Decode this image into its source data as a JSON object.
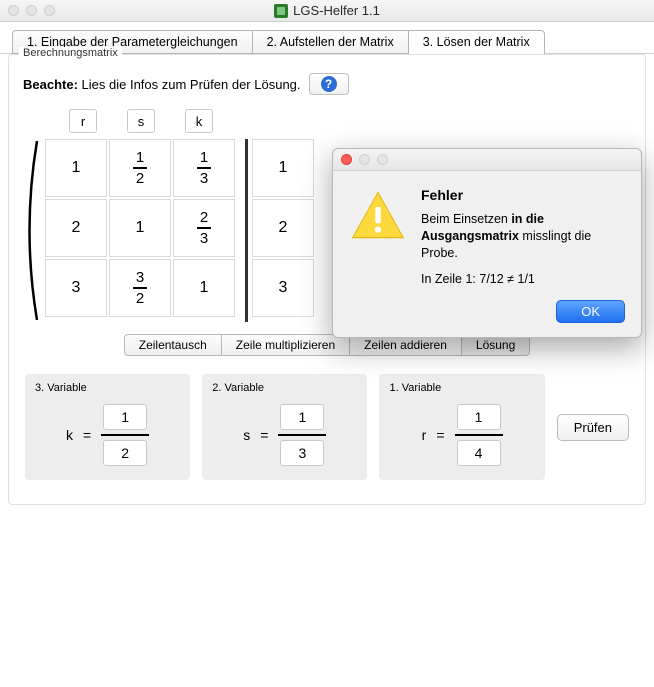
{
  "window": {
    "title": "LGS-Helfer 1.1"
  },
  "tabs": [
    {
      "label": "1. Eingabe der Parametergleichungen"
    },
    {
      "label": "2. Aufstellen der Matrix"
    },
    {
      "label": "3. Lösen der Matrix"
    }
  ],
  "frame_label": "Berechnungsmatrix",
  "notice": {
    "bold": "Beachte:",
    "text": "Lies die Infos zum Prüfen der Lösung."
  },
  "col_headers": [
    "r",
    "s",
    "k"
  ],
  "matrix": [
    [
      "1",
      {
        "n": "1",
        "d": "2"
      },
      {
        "n": "1",
        "d": "3"
      }
    ],
    [
      "2",
      "1",
      {
        "n": "2",
        "d": "3"
      }
    ],
    [
      "3",
      {
        "n": "3",
        "d": "2"
      },
      "1"
    ]
  ],
  "rhs": [
    "1",
    "2",
    "3"
  ],
  "ops_tabs": [
    "Zeilentausch",
    "Zeile multiplizieren",
    "Zeilen addieren",
    "Lösung"
  ],
  "ops_selected": 3,
  "solution": {
    "vars": [
      {
        "label": "3. Variable",
        "name": "k",
        "num": "1",
        "den": "2"
      },
      {
        "label": "2. Variable",
        "name": "s",
        "num": "1",
        "den": "3"
      },
      {
        "label": "1. Variable",
        "name": "r",
        "num": "1",
        "den": "4"
      }
    ],
    "check_label": "Prüfen"
  },
  "dialog": {
    "title": "Fehler",
    "msg_pre": "Beim Einsetzen ",
    "msg_bold": "in die Ausgangsmatrix",
    "msg_post": " misslingt die Probe.",
    "detail": "In Zeile 1: 7/12 ≠ 1/1",
    "ok": "OK"
  }
}
